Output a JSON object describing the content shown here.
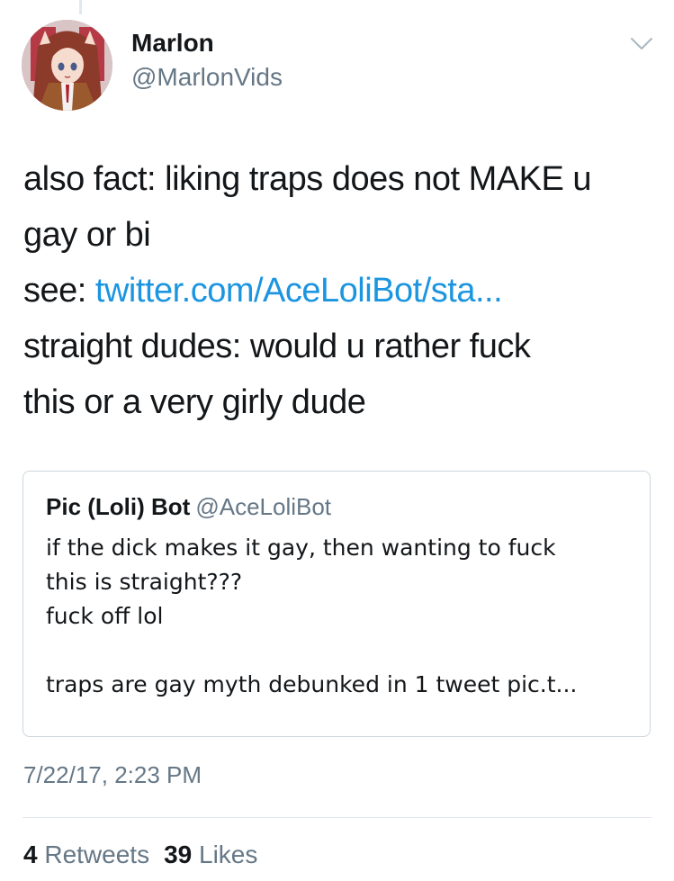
{
  "author": {
    "display_name": "Marlon",
    "handle": "@MarlonVids",
    "avatar": "anime-girl-avatar"
  },
  "tweet": {
    "line1": "also fact: liking traps does not MAKE u",
    "line2": "gay or bi",
    "line3_prefix": "see: ",
    "link_text": "twitter.com/AceLoliBot/sta...",
    "line4": "straight dudes: would u rather fuck",
    "line5": "this or a very girly dude"
  },
  "quoted_tweet": {
    "display_name": "Pic (Loli) Bot",
    "handle": "@AceLoliBot",
    "lines": [
      "if the dick makes it gay, then wanting to fuck",
      "this is straight???",
      "fuck off lol",
      "",
      "traps are gay myth debunked in 1 tweet pic.t..."
    ]
  },
  "timestamp": "7/22/17, 2:23 PM",
  "stats": {
    "retweets_count": "4",
    "retweets_label": "Retweets",
    "likes_count": "39",
    "likes_label": "Likes"
  },
  "icons": {
    "menu": "chevron-down-icon"
  },
  "colors": {
    "link": "#1b95e0",
    "secondary_text": "#657786",
    "primary_text": "#14171a",
    "border": "#ccd6dd"
  }
}
